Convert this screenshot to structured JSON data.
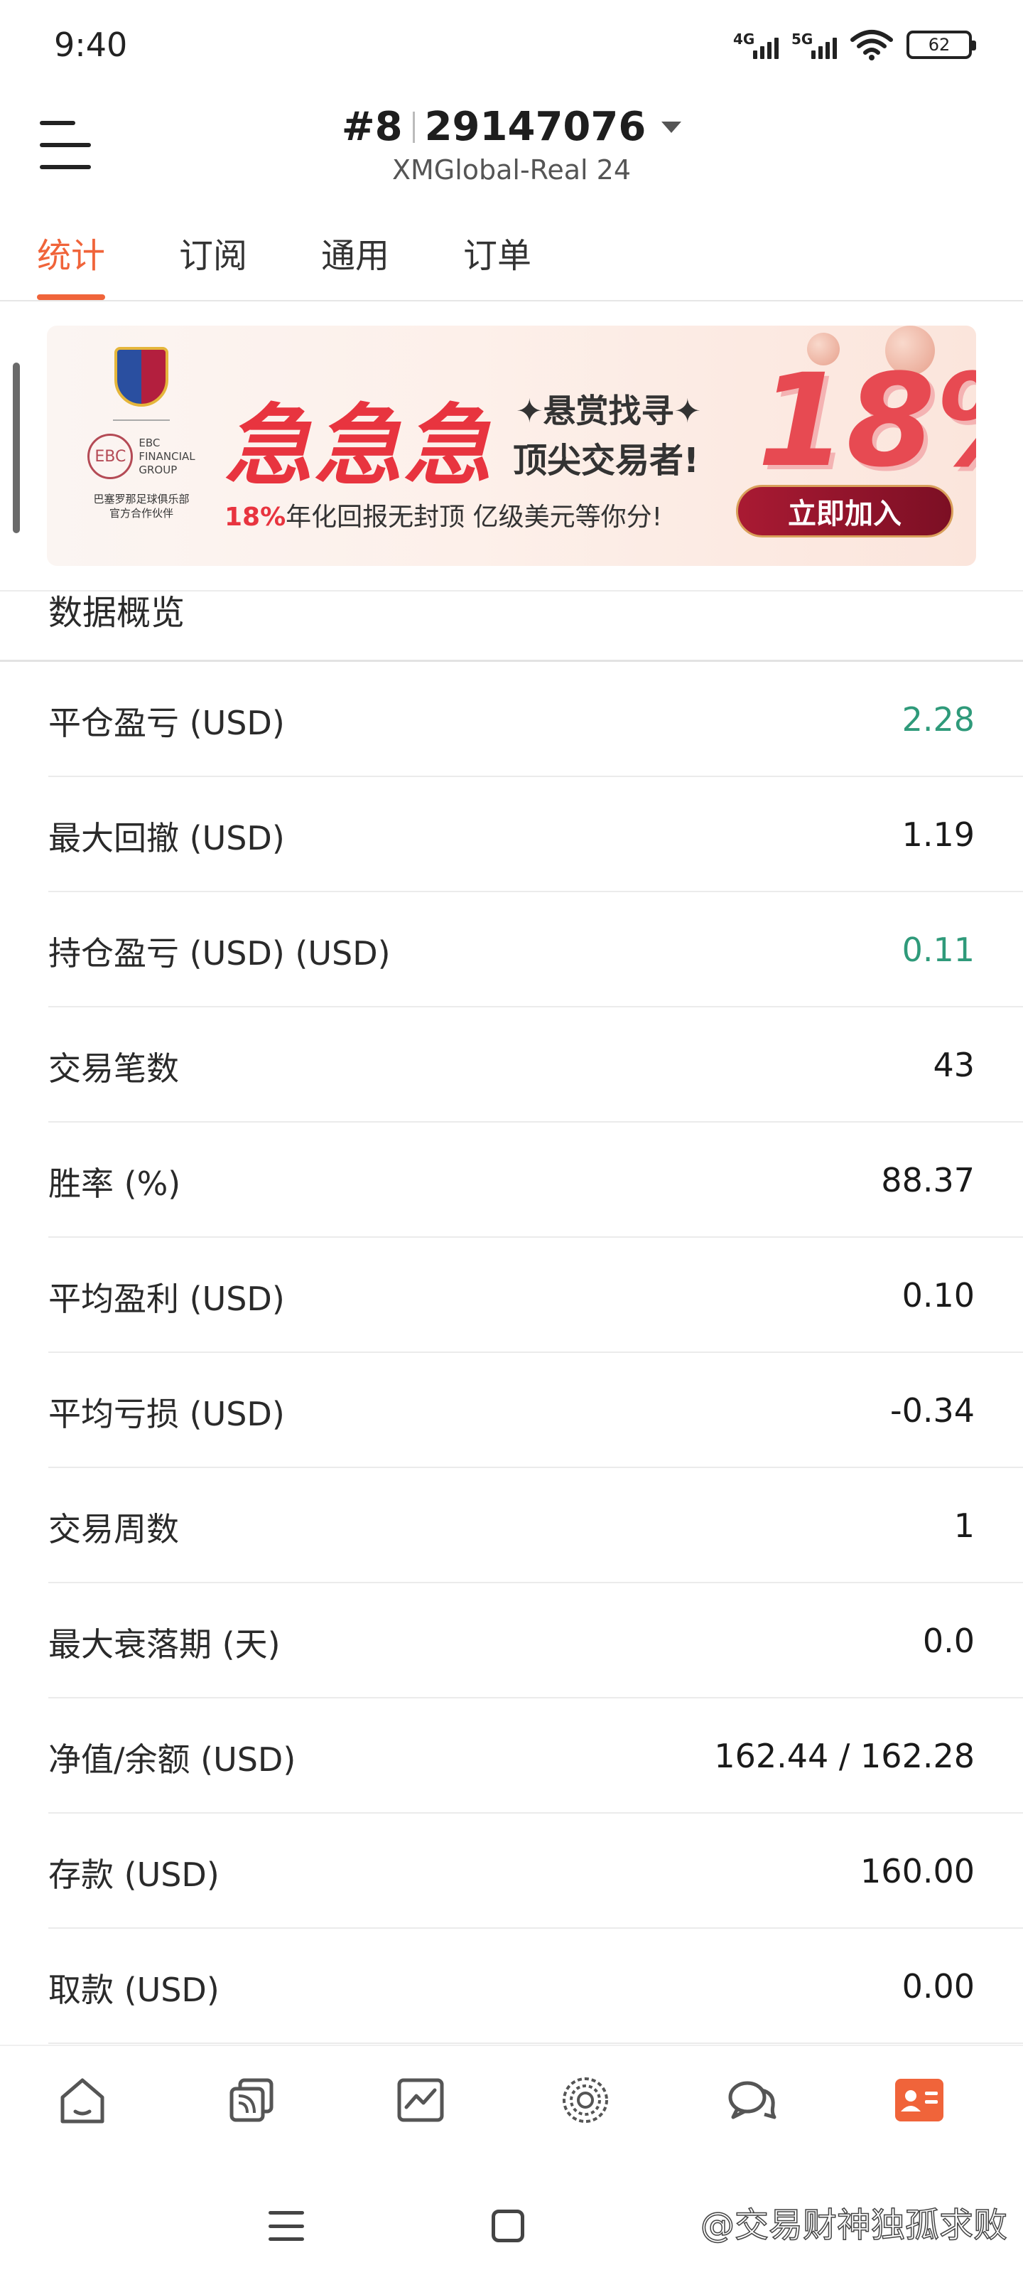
{
  "status_bar": {
    "time": "9:40",
    "network_1": "4G",
    "network_2": "5G",
    "battery": "62"
  },
  "header": {
    "account_prefix": "#8",
    "account_number": "29147076",
    "server": "XMGlobal-Real 24"
  },
  "tabs": [
    {
      "label": "统计",
      "active": true
    },
    {
      "label": "订阅",
      "active": false
    },
    {
      "label": "通用",
      "active": false
    },
    {
      "label": "订单",
      "active": false
    }
  ],
  "banner": {
    "ebc_short": "EBC",
    "ebc_line1": "EBC",
    "ebc_line2": "FINANCIAL",
    "ebc_line3": "GROUP",
    "partner_line1": "巴塞罗那足球俱乐部",
    "partner_line2": "官方合作伙伴",
    "headline": "急急急",
    "seek_line1": "✦悬赏找寻✦",
    "seek_line2": "顶尖交易者!",
    "sub_highlight": "18%",
    "sub_text": "年化回报无封顶 亿级美元等你分!",
    "big_percent": "18%",
    "cta": "立即加入"
  },
  "overview": {
    "title": "数据概览",
    "rows": [
      {
        "label": "平仓盈亏 (USD)",
        "value": "2.28",
        "color": "green"
      },
      {
        "label": "最大回撤 (USD)",
        "value": "1.19",
        "color": "default"
      },
      {
        "label": "持仓盈亏 (USD) (USD)",
        "value": "0.11",
        "color": "green"
      },
      {
        "label": "交易笔数",
        "value": "43",
        "color": "default"
      },
      {
        "label": "胜率 (%)",
        "value": "88.37",
        "color": "default"
      },
      {
        "label": "平均盈利 (USD)",
        "value": "0.10",
        "color": "default"
      },
      {
        "label": "平均亏损 (USD)",
        "value": "-0.34",
        "color": "default"
      },
      {
        "label": "交易周数",
        "value": "1",
        "color": "default"
      },
      {
        "label": "最大衰落期 (天)",
        "value": "0.0",
        "color": "default"
      },
      {
        "label": "净值/余额 (USD)",
        "value": "162.44 / 162.28",
        "color": "default"
      },
      {
        "label": "存款 (USD)",
        "value": "160.00",
        "color": "default"
      },
      {
        "label": "取款 (USD)",
        "value": "0.00",
        "color": "default"
      }
    ]
  },
  "bottom_nav": {
    "items": [
      {
        "icon": "home-icon"
      },
      {
        "icon": "copy-signal-icon"
      },
      {
        "icon": "chart-icon"
      },
      {
        "icon": "discover-icon"
      },
      {
        "icon": "chat-icon"
      },
      {
        "icon": "profile-card-icon",
        "active": true
      }
    ]
  },
  "watermark": "@交易财神独孤求败",
  "colors": {
    "accent": "#f0643a",
    "positive": "#2f9a7a",
    "banner_red": "#e8343f"
  }
}
